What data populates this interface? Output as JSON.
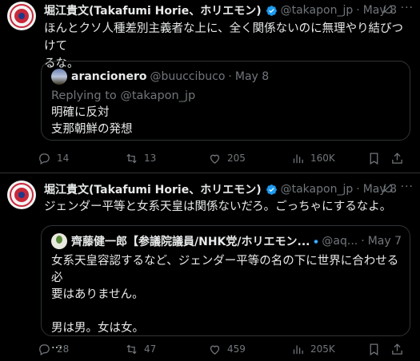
{
  "tweets": [
    {
      "name": "堀江貴文(Takafumi Horie、ホリエモン)",
      "handle": "@takapon_jp",
      "date": "May 8",
      "text_line1": "ほんとクソ人種差別主義者な上に、全く関係ないのに無理やり結びつけて",
      "text_line2": "るな。",
      "quote": {
        "name": "arancionero",
        "handle": "@buuccibuco",
        "date": "May 8",
        "replying": "Replying to @takapon_jp",
        "line1": "明確に反対",
        "line2": "支那朝鮮の発想"
      },
      "replies": "14",
      "reposts": "13",
      "likes": "205",
      "views": "160K"
    },
    {
      "name": "堀江貴文(Takafumi Horie、ホリエモン)",
      "handle": "@takapon_jp",
      "date": "May 8",
      "text_line1": "ジェンダー平等と女系天皇は関係ないだろ。ごっちゃにするなよ。",
      "quote": {
        "name": "齊藤健一郎【参議院議員/NHK党/ホリエモン...",
        "handle": "@aq...",
        "date": "May 7",
        "line1": "女系天皇容認するなど、ジェンダー平等の名の下に世界に合わせる必",
        "line2": "要はありません。",
        "line3": "男は男。女は女。",
        "line4": "..."
      },
      "replies": "28",
      "reposts": "47",
      "likes": "459",
      "views": "205K"
    }
  ],
  "colors": {
    "background": "#000000",
    "text": "#e7e9ea",
    "muted": "#71767b",
    "verified": "#1d9bf0",
    "border": "#2f3336"
  },
  "icons": [
    "verified-badge-icon",
    "grok-icon",
    "more-icon",
    "reply-icon",
    "repost-icon",
    "like-icon",
    "views-icon",
    "bookmark-icon",
    "share-icon"
  ]
}
